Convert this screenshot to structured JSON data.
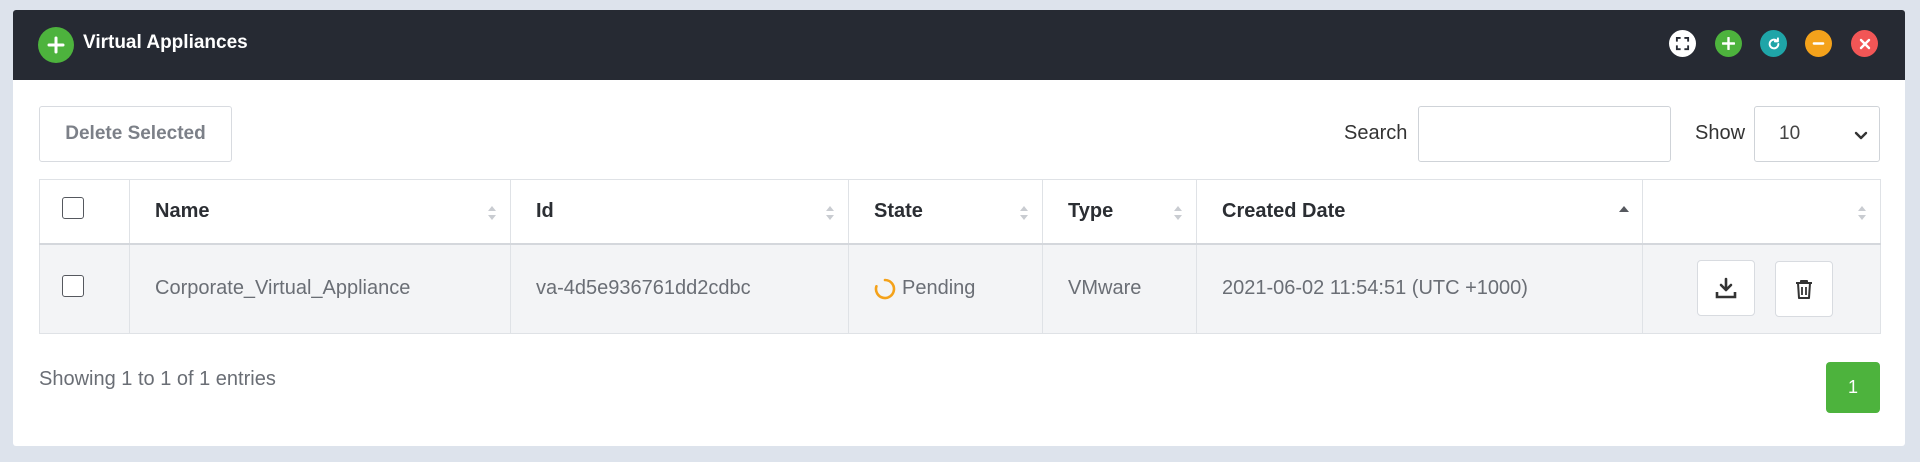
{
  "header": {
    "title": "Virtual Appliances",
    "buttons": [
      "expand-icon",
      "plus-icon",
      "refresh-icon",
      "minus-icon",
      "close-icon"
    ]
  },
  "toolbar": {
    "delete_label": "Delete Selected",
    "search_label": "Search",
    "search_value": "",
    "show_label": "Show",
    "show_value": "10"
  },
  "table": {
    "columns": [
      "Name",
      "Id",
      "State",
      "Type",
      "Created Date"
    ],
    "rows": [
      {
        "name": "Corporate_Virtual_Appliance",
        "id": "va-4d5e936761dd2cdbc",
        "state": "Pending",
        "type": "VMware",
        "created": "2021-06-02 11:54:51 (UTC +1000)"
      }
    ]
  },
  "footer": {
    "entries": "Showing 1 to 1 of 1 entries",
    "page": "1"
  },
  "colors": {
    "header_bg": "#262a33",
    "green": "#4db33d",
    "teal": "#1fa5a8",
    "orange": "#f4a21b",
    "red": "#f25656"
  }
}
